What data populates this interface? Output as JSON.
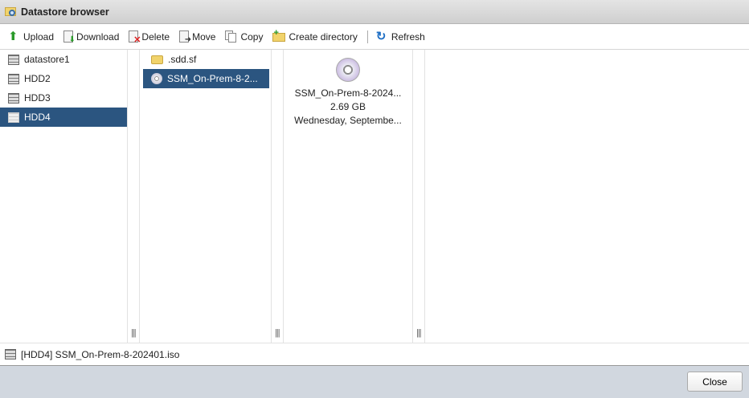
{
  "window": {
    "title": "Datastore browser"
  },
  "toolbar": {
    "upload": "Upload",
    "download": "Download",
    "delete": "Delete",
    "move": "Move",
    "copy": "Copy",
    "create_directory": "Create directory",
    "refresh": "Refresh"
  },
  "datastores": [
    {
      "label": "datastore1"
    },
    {
      "label": "HDD2"
    },
    {
      "label": "HDD3"
    },
    {
      "label": "HDD4",
      "selected": true
    }
  ],
  "files": [
    {
      "label": ".sdd.sf",
      "type": "folder"
    },
    {
      "label": "SSM_On-Prem-8-2...",
      "type": "iso",
      "selected": true
    }
  ],
  "details": {
    "name": "SSM_On-Prem-8-2024...",
    "size": "2.69 GB",
    "date": "Wednesday, Septembe..."
  },
  "resizer_glyph": "|||",
  "status": {
    "path": "[HDD4] SSM_On-Prem-8-202401.iso"
  },
  "footer": {
    "close": "Close"
  },
  "colors": {
    "selection": "#2b5580",
    "footer": "#d1d7df"
  }
}
